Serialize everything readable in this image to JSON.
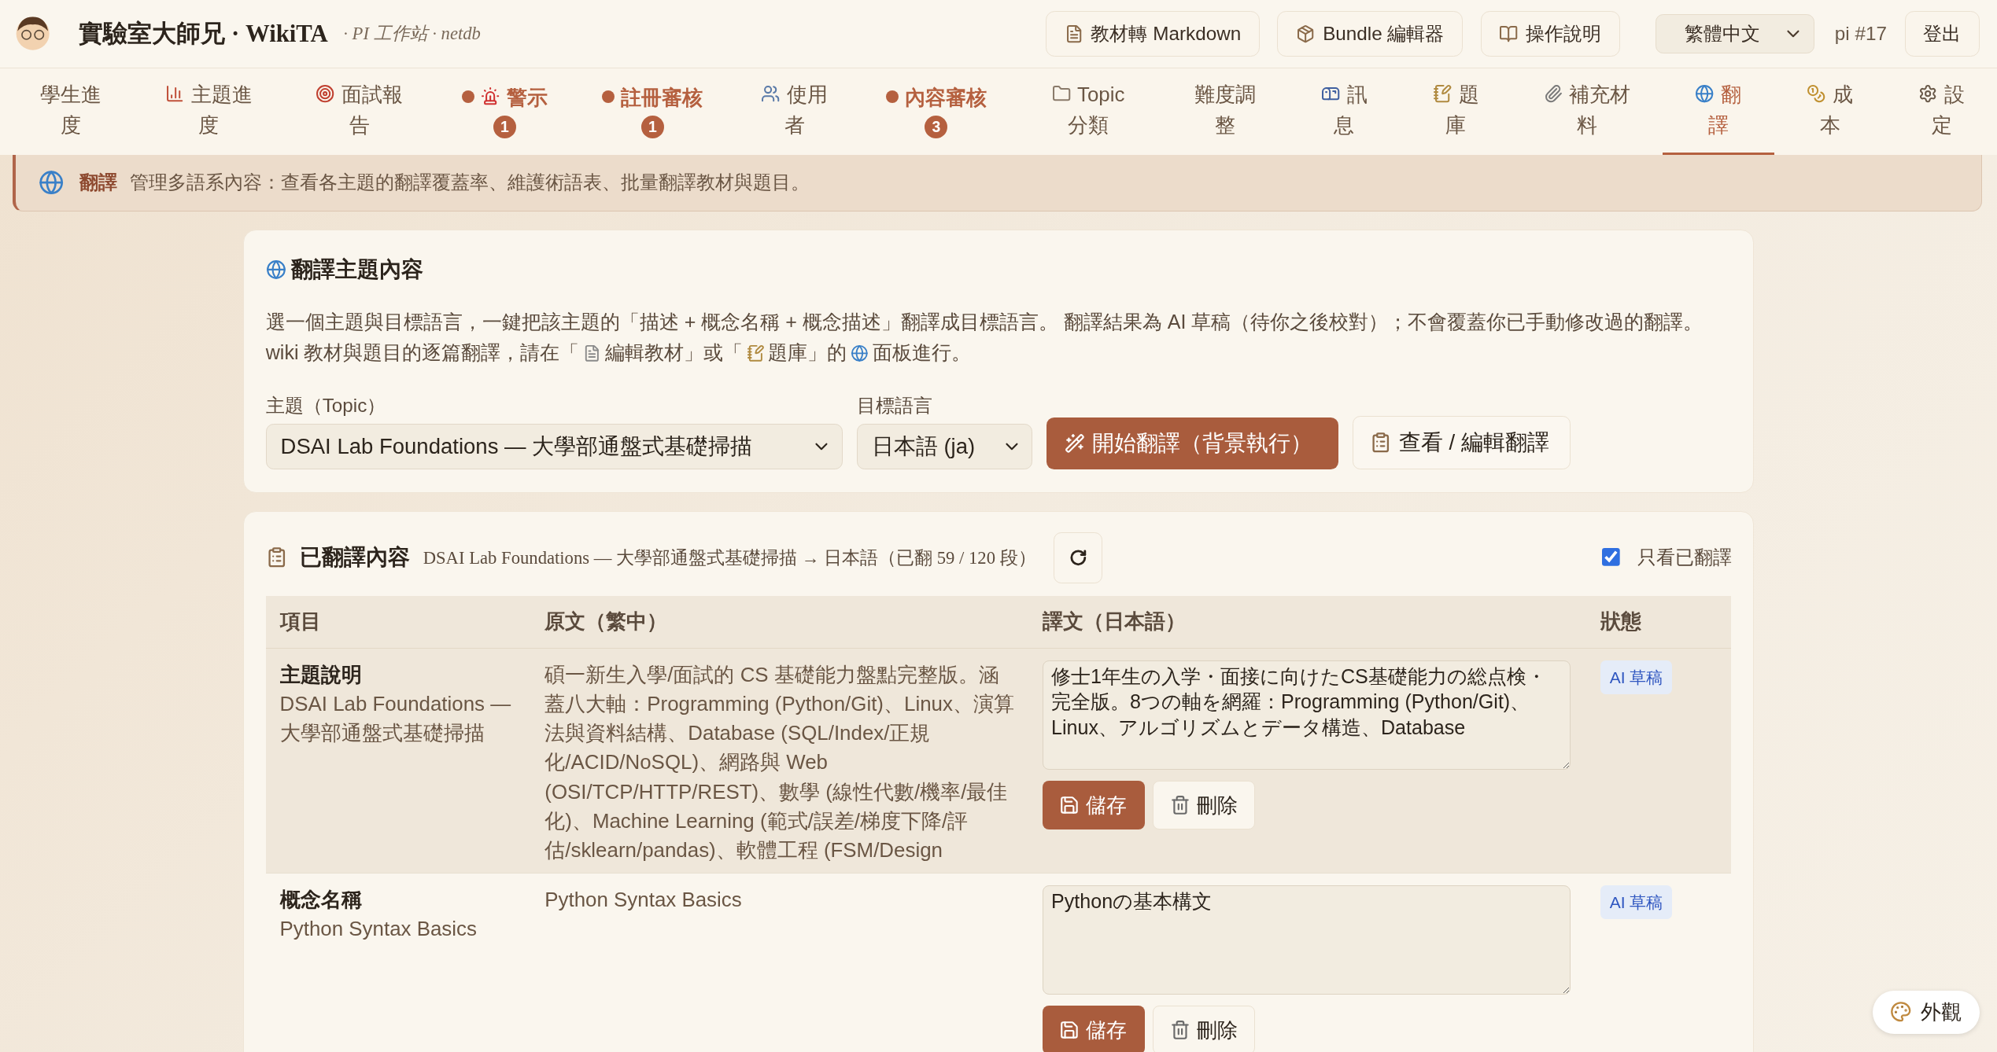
{
  "header": {
    "title": "實驗室大師兄 · WikiTA",
    "subtitle": "· PI 工作站 · netdb",
    "actions": [
      "教材轉 Markdown",
      "Bundle 編輯器",
      "操作說明"
    ],
    "language": "繁體中文",
    "user": "pi #17",
    "logout": "登出"
  },
  "tabs": [
    {
      "label": "學生進度",
      "selected": false,
      "alert": false
    },
    {
      "label": "主題進度",
      "selected": false,
      "alert": false
    },
    {
      "label": "面試報告",
      "selected": false,
      "alert": false
    },
    {
      "label": "警示",
      "selected": false,
      "alert": true,
      "badge": "1"
    },
    {
      "label": "註冊審核",
      "selected": false,
      "alert": true,
      "badge": "1"
    },
    {
      "label": "使用者",
      "selected": false,
      "alert": false
    },
    {
      "label": "內容審核",
      "selected": false,
      "alert": true,
      "badge": "3"
    },
    {
      "label": "Topic 分類",
      "selected": false,
      "alert": false
    },
    {
      "label": "難度調整",
      "selected": false,
      "alert": false
    },
    {
      "label": "訊息",
      "selected": false,
      "alert": false
    },
    {
      "label": "題庫",
      "selected": false,
      "alert": false
    },
    {
      "label": "補充材料",
      "selected": false,
      "alert": false
    },
    {
      "label": "翻譯",
      "selected": true,
      "alert": false
    },
    {
      "label": "成本",
      "selected": false,
      "alert": false
    },
    {
      "label": "設定",
      "selected": false,
      "alert": false
    }
  ],
  "banner": {
    "title": "翻譯",
    "text": "管理多語系內容：查看各主題的翻譯覆蓋率、維護術語表、批量翻譯教材與題目。"
  },
  "translate_card": {
    "title": "翻譯主題內容",
    "description": {
      "lead": "選一個主題與目標語言，一鍵把該主題的「描述 + 概念名稱 + 概念描述」翻譯成目標語言。 翻譯結果為 AI 草稿（待你之後校對）；不會覆蓋你已手動修改過的翻譯。",
      "parts": [
        "wiki 教材與題目的逐篇翻譯，請在「",
        "編輯教材」或「",
        "題庫」的",
        "面板進行。"
      ]
    },
    "topic_label": "主題（Topic）",
    "topic_value": "DSAI Lab Foundations — 大學部通盤式基礎掃描",
    "language_label": "目標語言",
    "language_value": "日本語 (ja)",
    "start_button": "開始翻譯（背景執行）",
    "view_button": "查看 / 編輯翻譯"
  },
  "translated_card": {
    "title": "已翻譯內容",
    "subtitle": "DSAI Lab Foundations — 大學部通盤式基礎掃描 → 日本語（已翻 59 / 120 段）",
    "filter": {
      "label": "只看已翻譯",
      "checked": true
    },
    "columns": [
      "項目",
      "原文（繁中）",
      "譯文（日本語）",
      "狀態"
    ],
    "rows": [
      {
        "item": "主題說明",
        "item_detail": "DSAI Lab Foundations — 大學部通盤式基礎掃描",
        "original": "碩一新生入學/面試的 CS 基礎能力盤點完整版。涵蓋八大軸：Programming (Python/Git)、Linux、演算法與資料結構、Database (SQL/Index/正規化/ACID/NoSQL)、網路與 Web (OSI/TCP/HTTP/REST)、數學 (線性代數/機率/最佳化)、Machine Learning (範式/誤差/梯度下降/評估/sklearn/pandas)、軟體工程 (FSM/Design",
        "translation": "修士1年生の入学・面接に向けたCS基礎能力の総点検・完全版。8つの軸を網羅：Programming (Python/Git)、Linux、アルゴリズムとデータ構造、Database",
        "status": "AI 草稿",
        "highlighted": true,
        "save": "儲存",
        "delete": "刪除"
      },
      {
        "item": "概念名稱",
        "item_detail": "Python Syntax Basics",
        "original": "Python Syntax Basics",
        "translation": "Pythonの基本構文",
        "status": "AI 草稿",
        "highlighted": false,
        "save": "儲存",
        "delete": "刪除"
      }
    ]
  },
  "appearance_button": "外觀"
}
